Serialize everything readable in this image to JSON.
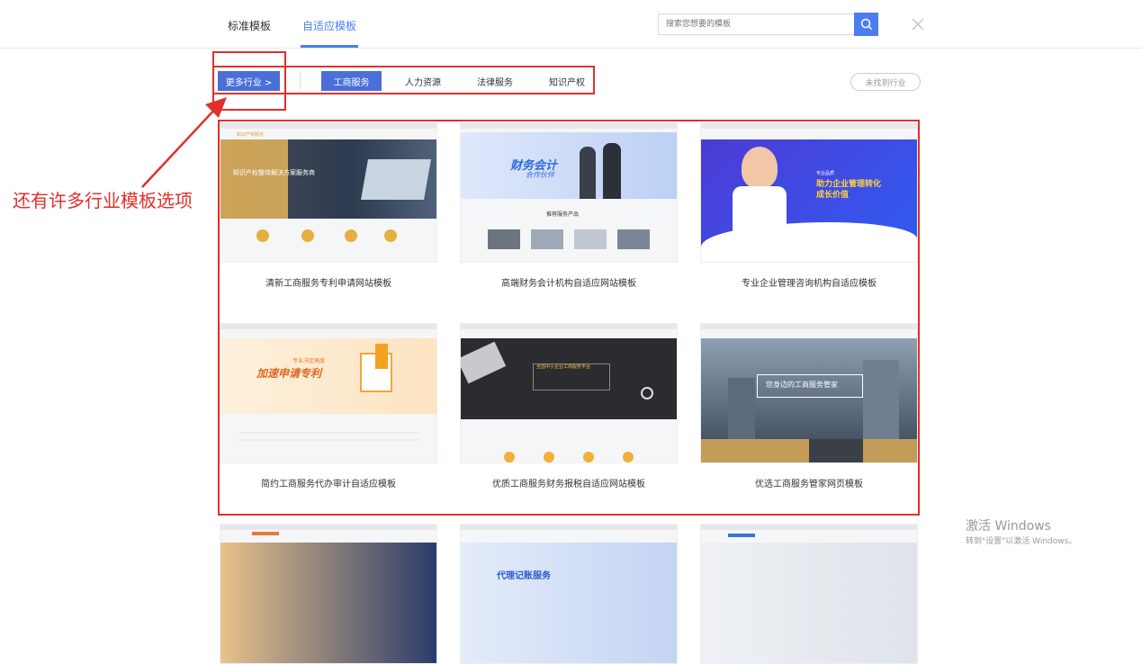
{
  "tabs": [
    {
      "label": "标准模板",
      "active": false
    },
    {
      "label": "自适应模板",
      "active": true
    }
  ],
  "search": {
    "placeholder": "搜索您想要的模板"
  },
  "more_industries_label": "更多行业 >",
  "industries": [
    "工商服务",
    "人力资源",
    "法律服务",
    "知识产权"
  ],
  "active_industry": "工商服务",
  "not_found_label": "未找到行业",
  "annotation": "还有许多行业模板选项",
  "templates": [
    {
      "title": "清新工商服务专利申请网站模板",
      "thumb_text": [
        "知识产权服务",
        "知识产权整体解决方案服务商"
      ]
    },
    {
      "title": "高端财务会计机构自适应网站模板",
      "thumb_text": [
        "财务会计",
        "合作伙伴",
        "推荐服务产品"
      ]
    },
    {
      "title": "专业企业管理咨询机构自适应模板",
      "thumb_text": [
        "专业品质",
        "助力企业管理转化",
        "成长价值"
      ]
    },
    {
      "title": "简约工商服务代办审计自适应模板",
      "thumb_text": [
        "专业决定高度",
        "加速申请专利"
      ]
    },
    {
      "title": "优质工商服务财务报税自适应网站模板",
      "thumb_text": [
        "全国中小企业工商服务平台"
      ]
    },
    {
      "title": "优选工商服务管家网页模板",
      "thumb_text": [
        "您身边的工商服务管家"
      ]
    },
    {
      "title": "",
      "thumb_text": []
    },
    {
      "title": "",
      "thumb_text": [
        "代理记账服务"
      ]
    },
    {
      "title": "",
      "thumb_text": []
    }
  ],
  "watermark": {
    "line1": "激活 Windows",
    "line2": "转到\"设置\"以激活 Windows。"
  },
  "colors": {
    "accent": "#4a7ef0",
    "annotation_red": "#e0302b",
    "industry_active": "#4a6fd8"
  }
}
